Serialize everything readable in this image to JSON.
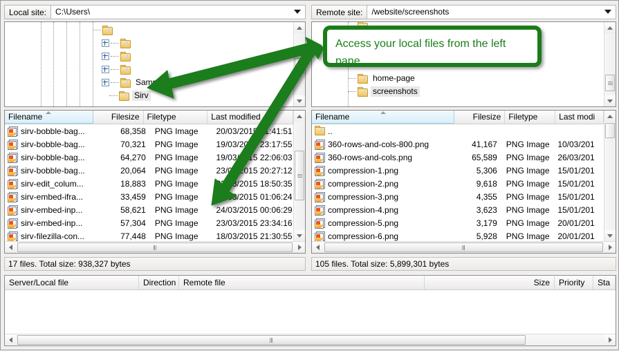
{
  "local": {
    "label": "Local site:",
    "path": "C:\\Users\\",
    "tree": [
      {
        "label": "",
        "expander": false
      },
      {
        "label": "",
        "expander": true
      },
      {
        "label": "",
        "expander": true
      },
      {
        "label": "",
        "expander": true
      },
      {
        "label": "Samples",
        "expander": true
      },
      {
        "label": "Sirv",
        "expander": false,
        "selected": true
      }
    ],
    "columns": [
      "Filename",
      "Filesize",
      "Filetype",
      "Last modified"
    ],
    "files": [
      {
        "name": "sirv-bobble-bag...",
        "size": "68,358",
        "type": "PNG Image",
        "modified": "20/03/2015 01:41:51"
      },
      {
        "name": "sirv-bobble-bag...",
        "size": "70,321",
        "type": "PNG Image",
        "modified": "19/03/2015 23:17:55"
      },
      {
        "name": "sirv-bobble-bag...",
        "size": "64,270",
        "type": "PNG Image",
        "modified": "19/03/2015 22:06:03"
      },
      {
        "name": "sirv-bobble-bag...",
        "size": "20,064",
        "type": "PNG Image",
        "modified": "23/03/2015 20:27:12"
      },
      {
        "name": "sirv-edit_colum...",
        "size": "18,883",
        "type": "PNG Image",
        "modified": "22/03/2015 18:50:35"
      },
      {
        "name": "sirv-embed-ifra...",
        "size": "33,459",
        "type": "PNG Image",
        "modified": "24/03/2015 01:06:24"
      },
      {
        "name": "sirv-embed-inp...",
        "size": "58,621",
        "type": "PNG Image",
        "modified": "24/03/2015 00:06:29"
      },
      {
        "name": "sirv-embed-inp...",
        "size": "57,304",
        "type": "PNG Image",
        "modified": "23/03/2015 23:34:16"
      },
      {
        "name": "sirv-filezilla-con...",
        "size": "77,448",
        "type": "PNG Image",
        "modified": "18/03/2015 21:30:55"
      }
    ],
    "status": "17 files. Total size: 938,327 bytes"
  },
  "remote": {
    "label": "Remote site:",
    "path": "/website/screenshots",
    "tree": [
      {
        "label": "home-page",
        "selected": false
      },
      {
        "label": "screenshots",
        "selected": true
      }
    ],
    "columns": [
      "Filename",
      "Filesize",
      "Filetype",
      "Last modi"
    ],
    "files": [
      {
        "name": "..",
        "size": "",
        "type": "",
        "modified": "",
        "isdir": true
      },
      {
        "name": "360-rows-and-cols-800.png",
        "size": "41,167",
        "type": "PNG Image",
        "modified": "10/03/201"
      },
      {
        "name": "360-rows-and-cols.png",
        "size": "65,589",
        "type": "PNG Image",
        "modified": "26/03/201"
      },
      {
        "name": "compression-1.png",
        "size": "5,306",
        "type": "PNG Image",
        "modified": "15/01/201"
      },
      {
        "name": "compression-2.png",
        "size": "9,618",
        "type": "PNG Image",
        "modified": "15/01/201"
      },
      {
        "name": "compression-3.png",
        "size": "4,355",
        "type": "PNG Image",
        "modified": "15/01/201"
      },
      {
        "name": "compression-4.png",
        "size": "3,623",
        "type": "PNG Image",
        "modified": "15/01/201"
      },
      {
        "name": "compression-5.png",
        "size": "3,179",
        "type": "PNG Image",
        "modified": "20/01/201"
      },
      {
        "name": "compression-6.png",
        "size": "5,928",
        "type": "PNG Image",
        "modified": "20/01/201"
      }
    ],
    "status": "105 files. Total size: 5,899,301 bytes"
  },
  "queue": {
    "columns": [
      "Server/Local file",
      "Direction",
      "Remote file",
      "Size",
      "Priority",
      "Sta"
    ]
  },
  "annotation": {
    "text": "Access your local files from the left pane.",
    "color": "#1a7d1a"
  }
}
